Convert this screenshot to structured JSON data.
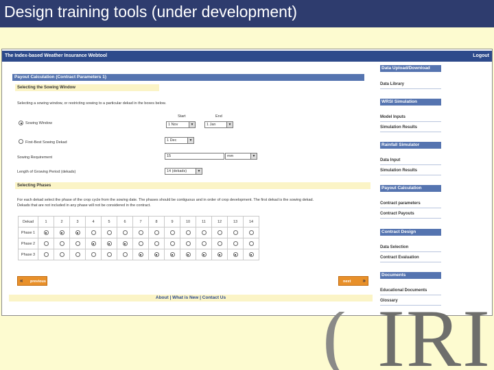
{
  "slide": {
    "title": "Design training tools (under development)"
  },
  "logo": {
    "text": "IRI"
  },
  "app": {
    "title": "The Index-based Weather Insurance Webtool",
    "logout": "Logout"
  },
  "form": {
    "section_title": "Payout Calculation (Contract Parameters 1)",
    "sowing_window_header": "Selecting the Sowing Window",
    "sowing_desc": "Selecting a sowing window, or restricting sowing to a particular dekad in the boxes below.",
    "start_label": "Start",
    "end_label": "End",
    "sowing_window_label": "Sowing Window",
    "start_value": "1 Nov",
    "end_value": "1 Jan",
    "fixed_label": "First-Best Sowing Dekad",
    "fixed_value": "1 Dec",
    "requirement_label": "Sowing Requirement",
    "requirement_value": "15",
    "requirement_unit": "mm",
    "length_label": "Length of Growing Period (dekads)",
    "length_value": "14 (dekads)",
    "phases_header": "Selecting Phases",
    "phases_desc_1": "For each dekad select the phase of the crop cycle from the sowing date. The phases should be contiguous and in order of crop development. The first dekad is the sowing dekad.",
    "phases_desc_2": "Dekads that are not included in any phase will not be considered in the contract.",
    "columns": [
      "Dekad",
      "1",
      "2",
      "3",
      "4",
      "5",
      "6",
      "7",
      "8",
      "9",
      "10",
      "11",
      "12",
      "13",
      "14"
    ],
    "rows": [
      {
        "label": "Phase 1",
        "selected": [
          0,
          1,
          2
        ]
      },
      {
        "label": "Phase 2",
        "selected": [
          3,
          4,
          5
        ]
      },
      {
        "label": "Phase 3",
        "selected": [
          6,
          7,
          8,
          9,
          10,
          11,
          12,
          13
        ]
      }
    ],
    "previous_label": "previous",
    "next_label": "next"
  },
  "footer": {
    "text": "About | What is New | Contact Us"
  },
  "sidebar": [
    {
      "head": "Data Upload/Download",
      "links": [
        "Data Library"
      ]
    },
    {
      "head": "WRSI Simulation",
      "links": [
        "Model Inputs",
        "Simulation Results"
      ]
    },
    {
      "head": "Rainfall Simulator",
      "links": [
        "Data Input",
        "Simulation Results"
      ]
    },
    {
      "head": "Payout Calculation",
      "links": [
        "Contract parameters",
        "Contract Payouts"
      ]
    },
    {
      "head": "Contract Design",
      "links": [
        "Data Selection",
        "Contract Evaluation"
      ]
    },
    {
      "head": "Documents",
      "links": [
        "Educational Documents",
        "Glossary"
      ]
    }
  ],
  "colors": {
    "title_bg": "#2e3c6e",
    "slide_bg": "#fdfbd0",
    "band": "#5574b0",
    "button": "#e8902a"
  }
}
